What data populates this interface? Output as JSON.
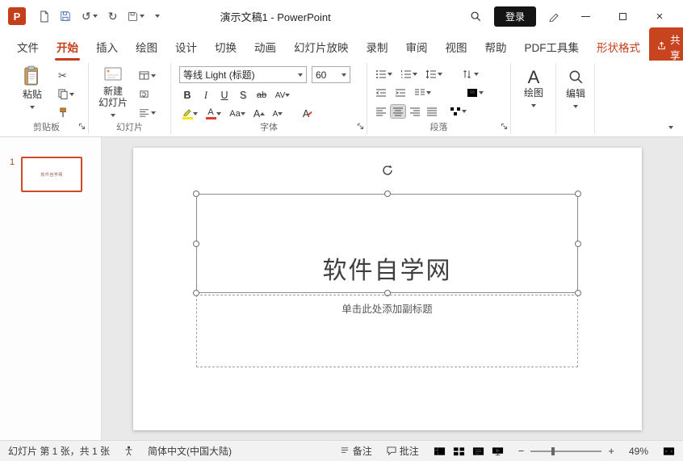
{
  "colors": {
    "accent": "#C43E1C",
    "share_button_bg": "#C8441F",
    "login_button_bg": "#141414",
    "highlight_color": "#F7E411",
    "font_color_swatch": "#E03C31"
  },
  "titlebar": {
    "title": "演示文稿1 - PowerPoint",
    "login_label": "登录"
  },
  "icons": {
    "dropdown": "⌄",
    "undo": "↺",
    "redo": "↻",
    "close": "×",
    "scissors": "✂",
    "minus": "−",
    "plus": "+"
  },
  "tabs": {
    "items": [
      {
        "label": "文件"
      },
      {
        "label": "开始"
      },
      {
        "label": "插入"
      },
      {
        "label": "绘图"
      },
      {
        "label": "设计"
      },
      {
        "label": "切换"
      },
      {
        "label": "动画"
      },
      {
        "label": "幻灯片放映"
      },
      {
        "label": "录制"
      },
      {
        "label": "审阅"
      },
      {
        "label": "视图"
      },
      {
        "label": "帮助"
      },
      {
        "label": "PDF工具集"
      },
      {
        "label": "形状格式"
      }
    ],
    "share_label": "共享"
  },
  "ribbon": {
    "clipboard": {
      "paste_label": "粘贴",
      "group_label": "剪贴板"
    },
    "slides": {
      "new_line1": "新建",
      "new_line2": "幻灯片",
      "group_label": "幻灯片"
    },
    "font": {
      "name": "等线 Light (标题)",
      "size": "60",
      "bold": "B",
      "italic": "I",
      "underline": "U",
      "shadow": "S",
      "strike": "ab",
      "spacing": "AV",
      "case": "Aa",
      "color_letter": "A",
      "grow_letter": "A",
      "shrink_letter": "A",
      "clear_letter": "A",
      "group_label": "字体"
    },
    "paragraph": {
      "group_label": "段落"
    },
    "drawing": {
      "label": "绘图",
      "big_letter": "A"
    },
    "editing": {
      "label": "编辑"
    }
  },
  "slide_panel": {
    "number": "1",
    "thumb_title": "软件自学网"
  },
  "canvas": {
    "title": "软件自学网",
    "subtitle": "单击此处添加副标题"
  },
  "statusbar": {
    "slide_info": "幻灯片 第 1 张，共 1 张",
    "language": "简体中文(中国大陆)",
    "notes": "备注",
    "comments": "批注",
    "zoom": "49%"
  }
}
